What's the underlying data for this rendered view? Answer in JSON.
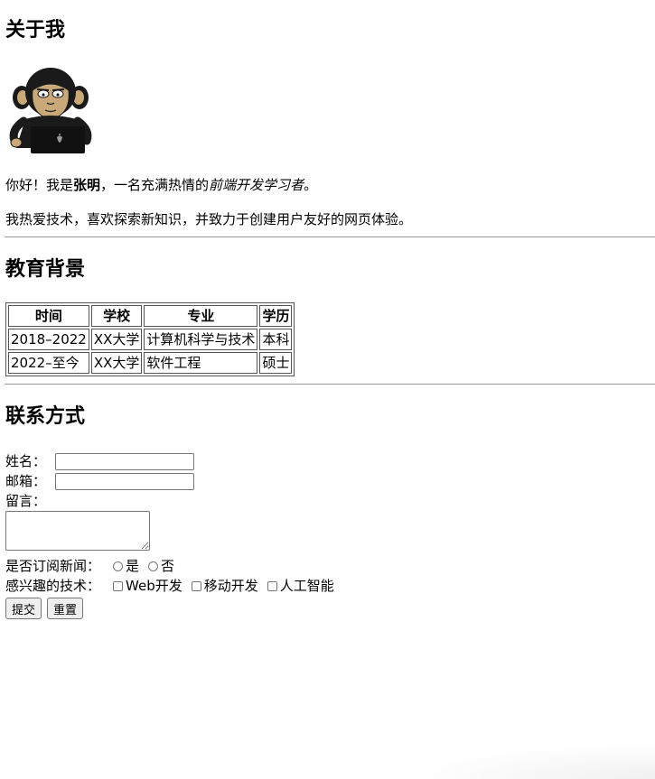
{
  "about": {
    "heading": "关于我",
    "avatar_icon": "monkey-with-laptop-icon",
    "p1_prefix": "你好！我是",
    "p1_name": "张明",
    "p1_middle": "，一名充满热情的",
    "p1_role": "前端开发学习者",
    "p1_suffix": "。",
    "p2": "我热爱技术，喜欢探索新知识，并致力于创建用户友好的网页体验。"
  },
  "education": {
    "heading": "教育背景",
    "headers": [
      "时间",
      "学校",
      "专业",
      "学历"
    ],
    "rows": [
      [
        "2018–2022",
        "XX大学",
        "计算机科学与技术",
        "本科"
      ],
      [
        "2022–至今",
        "XX大学",
        "软件工程",
        "硕士"
      ]
    ]
  },
  "contact": {
    "heading": "联系方式",
    "name_label": "姓名：",
    "name_value": "",
    "email_label": "邮箱：",
    "email_value": "",
    "message_label": "留言：",
    "message_value": "",
    "subscribe_label": "是否订阅新闻：",
    "subscribe_yes": "是",
    "subscribe_no": "否",
    "interest_label": "感兴趣的技术：",
    "interest_options": [
      "Web开发",
      "移动开发",
      "人工智能"
    ],
    "submit": "提交",
    "reset": "重置"
  }
}
